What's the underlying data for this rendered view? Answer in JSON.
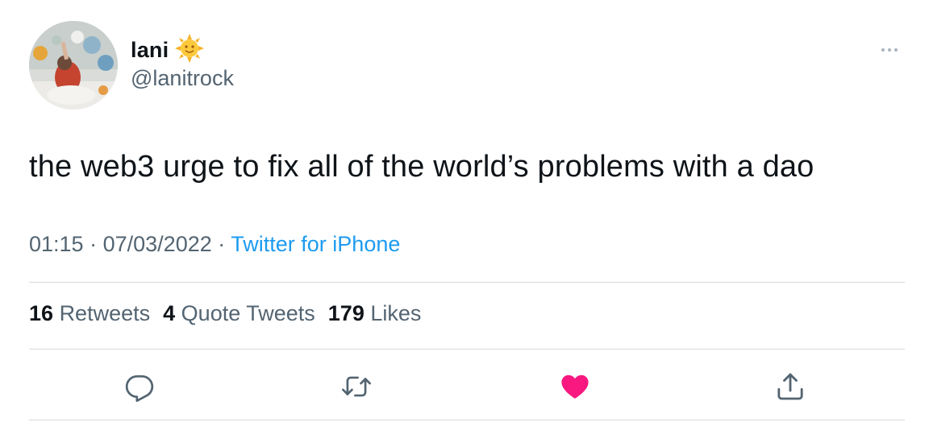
{
  "author": {
    "display_name": "lani",
    "emoji": "🌞",
    "handle": "@lanitrock"
  },
  "tweet": {
    "text": "the web3 urge to fix all of the world’s problems with a dao",
    "time": "01:15",
    "date": "07/03/2022",
    "separator": "·",
    "source": "Twitter for iPhone"
  },
  "stats": {
    "retweets_count": "16",
    "retweets_label": "Retweets",
    "quotes_count": "4",
    "quotes_label": "Quote Tweets",
    "likes_count": "179",
    "likes_label": "Likes"
  },
  "actions": {
    "reply_icon": "reply-icon",
    "retweet_icon": "retweet-icon",
    "like_icon": "heart-icon",
    "like_state": "liked",
    "share_icon": "share-icon"
  },
  "colors": {
    "text": "#0f1419",
    "secondary": "#536471",
    "link": "#1d9bf0",
    "like": "#f91880",
    "divider": "#d6dbdf"
  }
}
